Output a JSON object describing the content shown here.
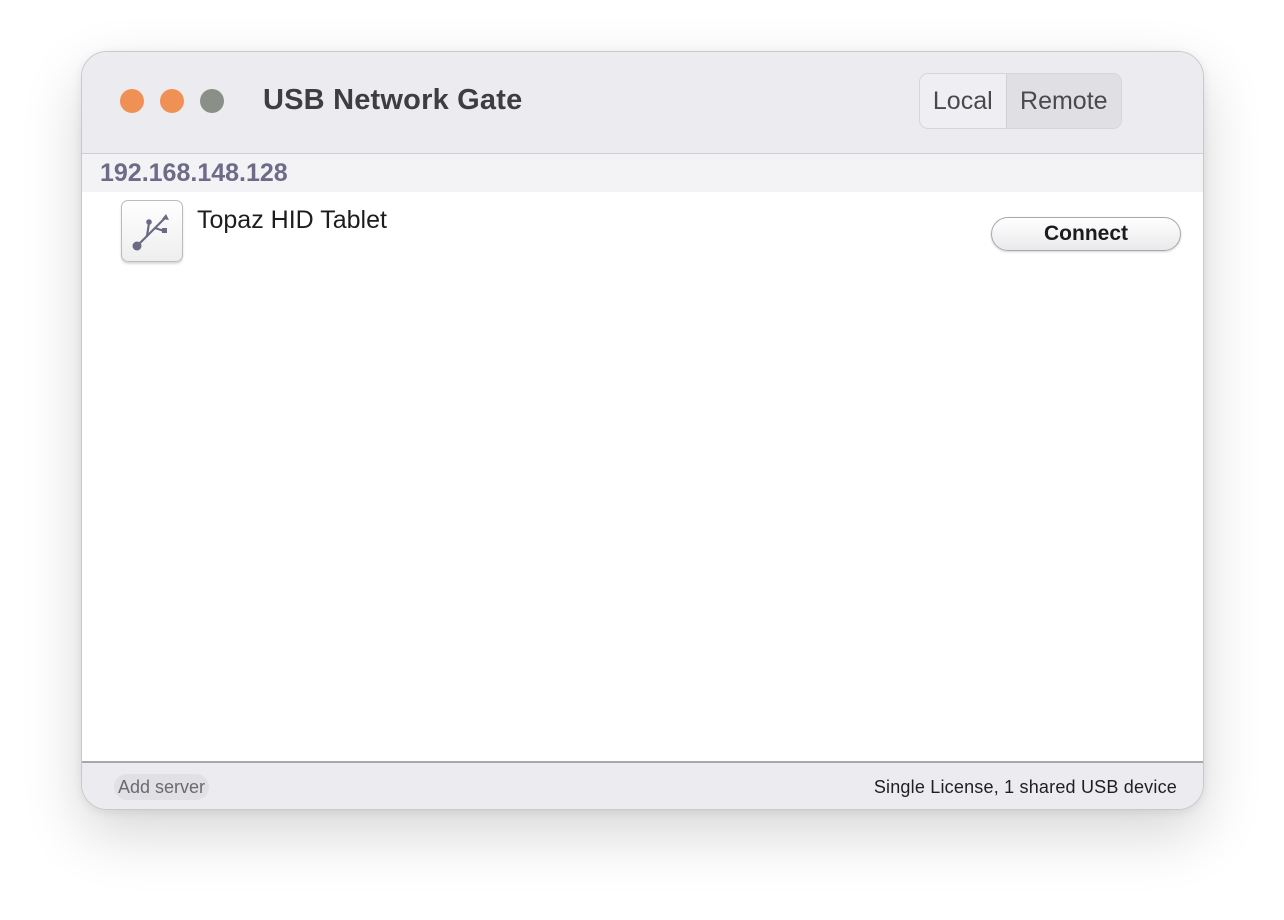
{
  "window": {
    "title": "USB Network Gate",
    "traffic_lights": {
      "close_color": "#ef9155",
      "minimize_color": "#ef9155",
      "zoom_color": "#8a8f87"
    }
  },
  "mode_tabs": {
    "local_label": "Local",
    "remote_label": "Remote",
    "selected": "Remote"
  },
  "server": {
    "address": "192.168.148.128",
    "address_color": "#6c6b88"
  },
  "devices": [
    {
      "name": "Topaz HID Tablet",
      "icon": "usb-icon",
      "action_label": "Connect"
    }
  ],
  "statusbar": {
    "add_server_label": "Add server",
    "license_text": "Single License, 1 shared USB device"
  }
}
